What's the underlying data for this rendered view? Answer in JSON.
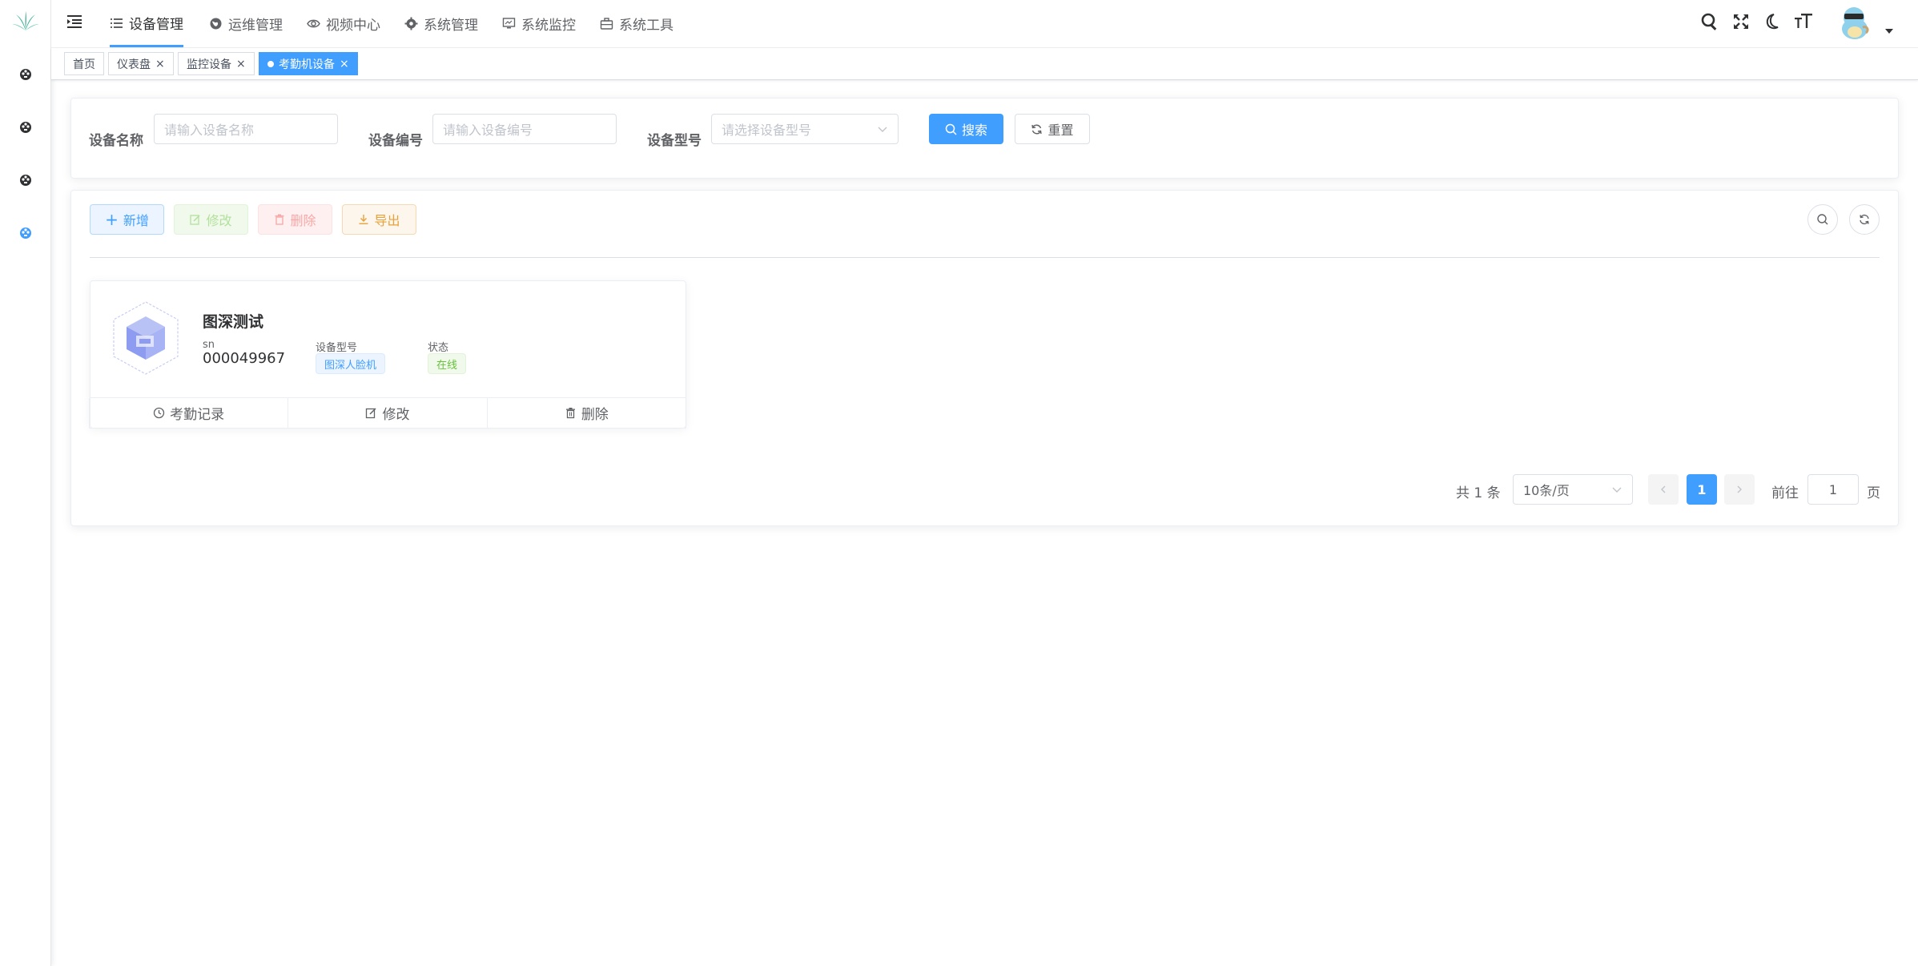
{
  "header": {
    "menu": [
      {
        "label": "设备管理",
        "icon": "list-icon",
        "active": true
      },
      {
        "label": "运维管理",
        "icon": "globe-icon",
        "active": false
      },
      {
        "label": "视频中心",
        "icon": "eye-icon",
        "active": false
      },
      {
        "label": "系统管理",
        "icon": "gear-icon",
        "active": false
      },
      {
        "label": "系统监控",
        "icon": "monitor-icon",
        "active": false
      },
      {
        "label": "系统工具",
        "icon": "toolbox-icon",
        "active": false
      }
    ]
  },
  "tags": [
    {
      "label": "首页",
      "closable": false,
      "active": false
    },
    {
      "label": "仪表盘",
      "closable": true,
      "active": false
    },
    {
      "label": "监控设备",
      "closable": true,
      "active": false
    },
    {
      "label": "考勤机设备",
      "closable": true,
      "active": true
    }
  ],
  "search": {
    "name_label": "设备名称",
    "name_placeholder": "请输入设备名称",
    "code_label": "设备编号",
    "code_placeholder": "请输入设备编号",
    "model_label": "设备型号",
    "model_placeholder": "请选择设备型号",
    "search_btn": "搜索",
    "reset_btn": "重置"
  },
  "toolbar": {
    "add": "新增",
    "edit": "修改",
    "delete": "删除",
    "export": "导出"
  },
  "devices": [
    {
      "name": "图深测试",
      "sn_label": "sn",
      "sn": "000049967",
      "model_label": "设备型号",
      "model": "图深人脸机",
      "status_label": "状态",
      "status": "在线",
      "actions": [
        "考勤记录",
        "修改",
        "删除"
      ]
    }
  ],
  "pagination": {
    "total": "共 1 条",
    "page_size": "10条/页",
    "current": "1",
    "goto_label": "前往",
    "goto_value": "1",
    "page_suffix": "页"
  },
  "colors": {
    "primary": "#409eff",
    "success": "#67c23a",
    "danger": "#f56c6c",
    "warning": "#e6a23c"
  }
}
